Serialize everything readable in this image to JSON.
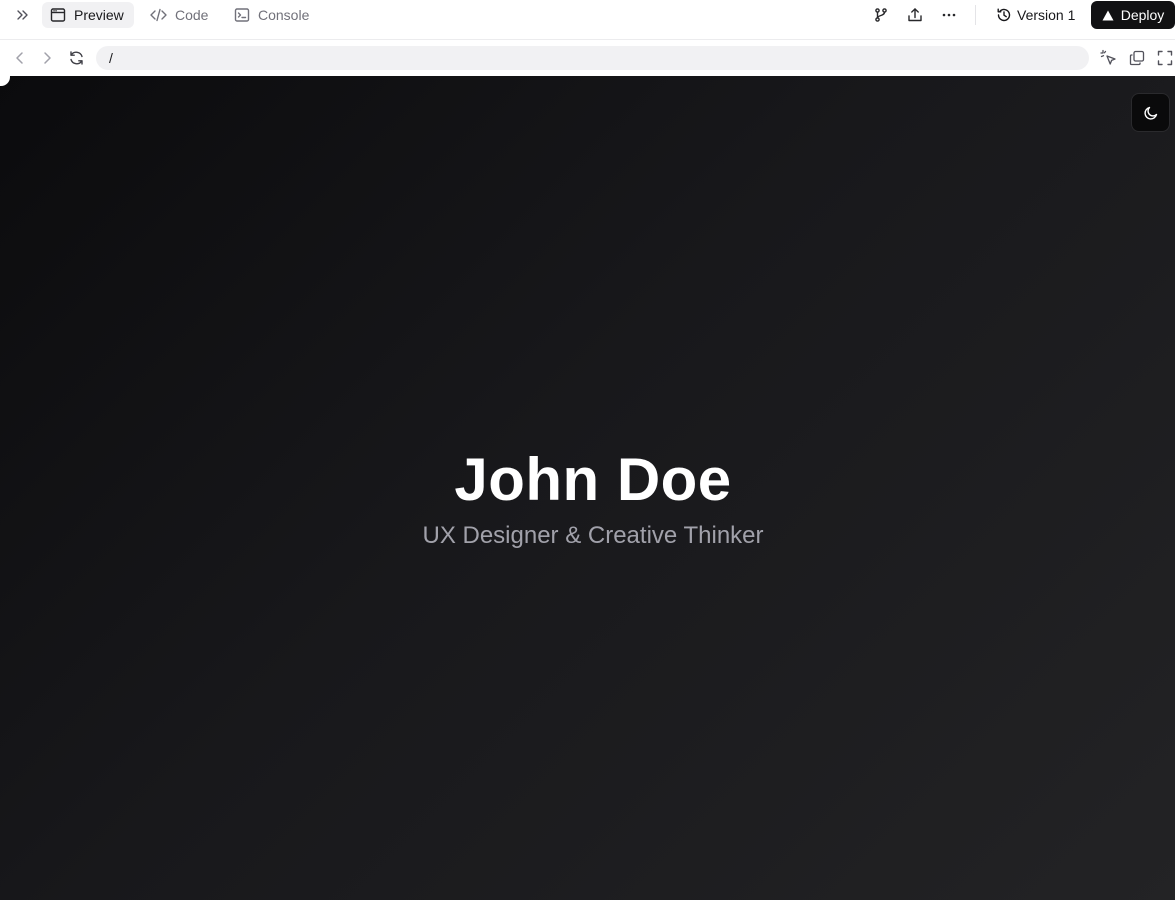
{
  "topbar": {
    "tabs": [
      {
        "label": "Preview",
        "icon": "browser-window-icon",
        "active": true
      },
      {
        "label": "Code",
        "icon": "code-brackets-icon",
        "active": false
      },
      {
        "label": "Console",
        "icon": "terminal-icon",
        "active": false
      }
    ],
    "actions": [
      "git-branch-icon",
      "share-upload-icon",
      "more-horizontal-icon"
    ],
    "version_label": "Version 1",
    "deploy_label": "Deploy"
  },
  "address_bar": {
    "url": "/"
  },
  "preview": {
    "name": "John Doe",
    "tagline": "UX Designer & Creative Thinker"
  },
  "colors": {
    "accent": "#111113",
    "preview_bg_start": "#0b0b0d",
    "preview_bg_end": "#232325",
    "tagline": "#a1a1aa"
  }
}
